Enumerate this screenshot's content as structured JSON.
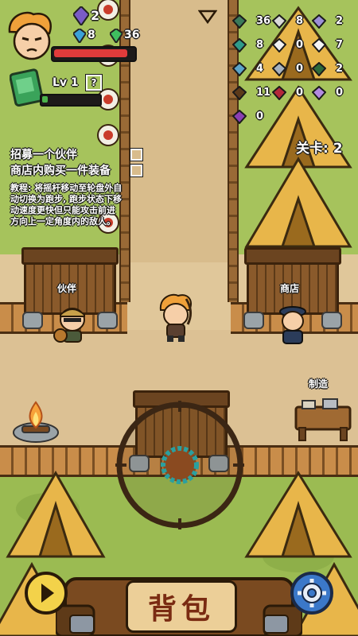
{
  "hud": {
    "gems": {
      "value": "2",
      "color": "#7a5cc7"
    },
    "blue_crystal": "8",
    "green_crystal": "36",
    "level_label": "Lv 1",
    "level_help": "?",
    "hp_fraction": 0.92,
    "xp_fraction": 0.1,
    "dropdown_icon": "triangle-down-icon"
  },
  "resources": [
    {
      "icon": "stick-icon",
      "count": "36"
    },
    {
      "icon": "bone-icon",
      "count": "8"
    },
    {
      "icon": "iron-ore-icon",
      "count": "2"
    },
    {
      "icon": "green-leaf-icon",
      "count": "8"
    },
    {
      "icon": "white-crystal-icon",
      "count": "0"
    },
    {
      "icon": "tooth-icon",
      "count": "7"
    },
    {
      "icon": "feather-icon",
      "count": "4"
    },
    {
      "icon": "horn-icon",
      "count": "0"
    },
    {
      "icon": "rope-icon",
      "count": "2"
    },
    {
      "icon": "hide-icon",
      "count": "11"
    },
    {
      "icon": "red-gem-icon",
      "count": "0"
    },
    {
      "icon": "purple-crystal-icon",
      "count": "0"
    },
    {
      "icon": "purple-orb-icon",
      "count": "0"
    }
  ],
  "quests": [
    {
      "text": "招募一个伙伴"
    },
    {
      "text": "商店内购买一件装备"
    }
  ],
  "level_indicator": "关卡: 2",
  "tutorial": {
    "lines": [
      "教程: 将摇杆移动至轮盘外自",
      "动切换为跑步, 跑步状态下移",
      "动速度更快但只能攻击前进",
      "方向上一定角度内的敌人。"
    ]
  },
  "buildings": {
    "partner_label": "伙伴",
    "shop_label": "商店",
    "craft_label": "制造"
  },
  "bottom_bar": {
    "backpack_label": "背包",
    "play_icon": "play-icon",
    "settings_icon": "gear-icon"
  },
  "colors": {
    "grass": "#9bbb52",
    "dirt": "#e0c79a",
    "hp_red": "#e23b3b",
    "xp_green": "#4bb34b",
    "tent": "#e8b64a",
    "backpack_text": "#7a2b12"
  }
}
